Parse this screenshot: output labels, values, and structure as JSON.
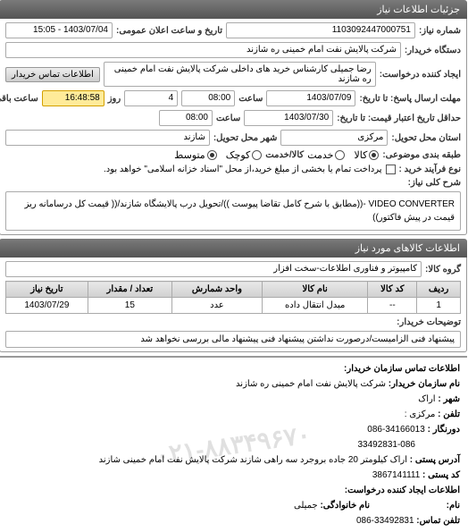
{
  "header": {
    "title": "جزئیات اطلاعات نیاز"
  },
  "main": {
    "req_no_label": "شماره نیاز:",
    "req_no": "1103092447000751",
    "public_dt_label": "تاریخ و ساعت اعلان عمومی:",
    "public_dt": "1403/07/04 - 15:05",
    "buyer_org_label": "دستگاه خریدار:",
    "buyer_org": "شرکت پالایش نفت امام خمینی  ره  شازند",
    "creator_label": "ایجاد کننده درخواست:",
    "creator": "رضا جمیلی کارشناس خرید های داخلی  شرکت پالایش نفت امام خمینی  ره  شازند",
    "btn_buyer_contact": "اطلاعات تماس خریدار",
    "deadline_label": "مهلت ارسال پاسخ: تا تاریخ:",
    "deadline_date": "1403/07/09",
    "time_label": "ساعت",
    "deadline_time": "08:00",
    "days_remain": "4",
    "days_label": "روز",
    "countdown": "16:48:58",
    "remain_label": "ساعت باقی مانده",
    "price_valid_label": "حداقل تاریخ اعتبار قیمت: تا تاریخ:",
    "price_valid_date": "1403/07/30",
    "price_valid_time": "08:00",
    "city_label": "استان محل تحویل:",
    "city_value": "مرکزی",
    "delivery_city_label": "شهر محل تحویل:",
    "delivery_city_value": "شازند",
    "budget_label": "طبقه بندی موضوعی:",
    "rad_goods": "کالا",
    "rad_service": "خدمت",
    "cur_label": "کالا/خدمت",
    "rad_small": "کوچک",
    "rad_med": "متوسط",
    "pay_type_label": "نوع فرآیند خرید :",
    "chk_pay": "پرداخت تمام یا بخشی از مبلغ خرید،از محل \"اسناد خزانه اسلامی\" خواهد بود.",
    "desc_label": "شرح کلی نیاز:",
    "desc_text": "VIDEO CONVERTER -((مطابق با شرح کامل تقاضا پیوست ))/تحویل درب پالایشگاه شازند/(( قیمت کل درسامانه ریز قیمت در پیش فاکتور))"
  },
  "items_section": {
    "header": "اطلاعات کالاهای مورد نیاز",
    "group_label": "گروه کالا:",
    "group_value": "کامپیوتر و فناوری اطلاعات-سخت افزار",
    "cols": {
      "row": "ردیف",
      "code": "کد کالا",
      "name": "نام کالا",
      "unit": "واحد شمارش",
      "qty": "تعداد / مقدار",
      "date": "تاریخ نیاز"
    },
    "row": {
      "n": "1",
      "code": "--",
      "name": "مبدل انتقال داده",
      "unit": "عدد",
      "qty": "15",
      "date": "1403/07/29"
    },
    "buyer_note_label": "توضیحات خریدار:",
    "buyer_note": "پیشنهاد فنی الزامیست/درصورت نداشتن پیشنهاد فنی پیشنهاد مالی بررسی نخواهد شد"
  },
  "contact": {
    "header": "اطلاعات تماس سازمان خریدار:",
    "org_label": "نام سازمان خریدار:",
    "org": "شرکت پالایش نفت امام خمینی ره شازند",
    "city_label": "شهر :",
    "city": "اراک",
    "tel_label": "تلفن :",
    "tel": "مرکزی :",
    "fax_label": "دورنگار :",
    "fax": "34166013-086",
    "fax2": "33492831-086",
    "addr_label": "آدرس پستی :",
    "addr": "اراک کیلومتر 20 جاده بروجرد سه راهی شازند شرکت پالایش نفت امام خمینی شازند",
    "post_label": "کد پستی :",
    "post": "3867141111",
    "creator_label": "اطلاعات ایجاد کننده درخواست:",
    "name_label": "نام:",
    "name_fam_label": "نام خانوادگی:",
    "name_fam": "جمیلی",
    "tel2_label": "تلفن تماس:",
    "tel2": "33492831-086",
    "watermark": "۰۲۱-۸۸۳۴۹۶۷۰"
  }
}
